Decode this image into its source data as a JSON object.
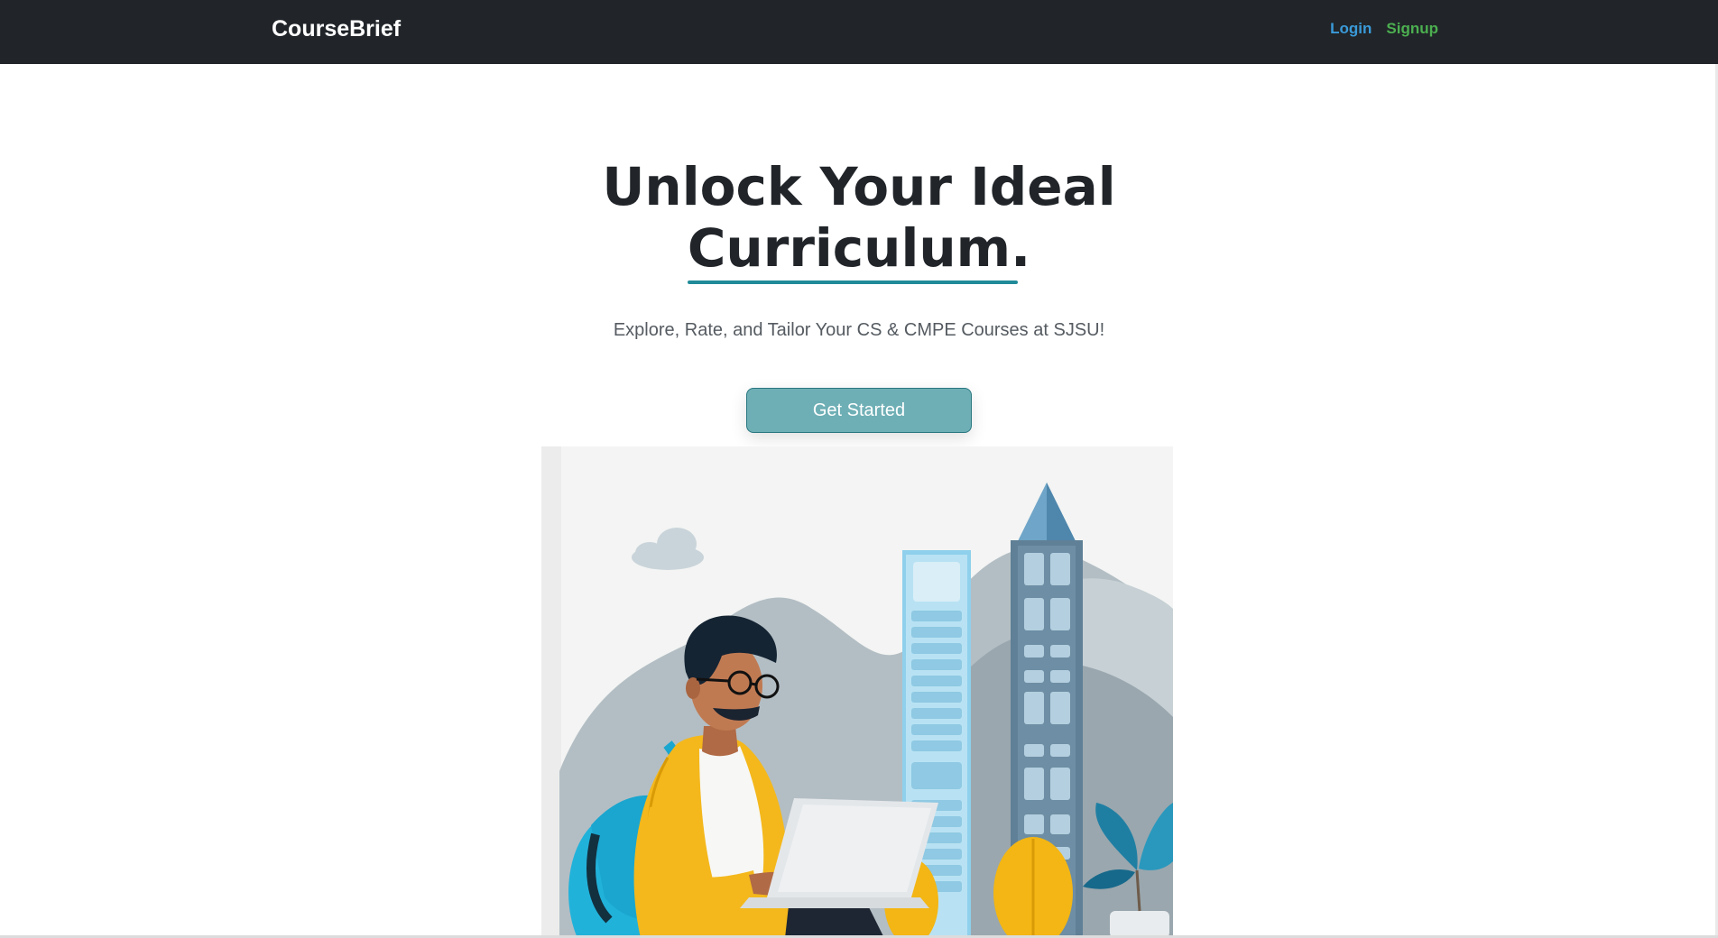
{
  "navbar": {
    "brand": "CourseBrief",
    "login": "Login",
    "signup": "Signup"
  },
  "hero": {
    "headline_line1": "Unlock Your Ideal",
    "headline_line2": "Curriculum.",
    "subtitle": "Explore, Rate, and Tailor Your CS & CMPE Courses at SJSU!",
    "cta_label": "Get Started"
  },
  "colors": {
    "navbar_bg": "#212529",
    "login_link": "#3a9ad9",
    "signup_link": "#4caf50",
    "underline_accent": "#1f8a98",
    "cta_bg": "#6eafb5"
  },
  "illustration": {
    "description_icon": "student-laptop-illustration"
  }
}
